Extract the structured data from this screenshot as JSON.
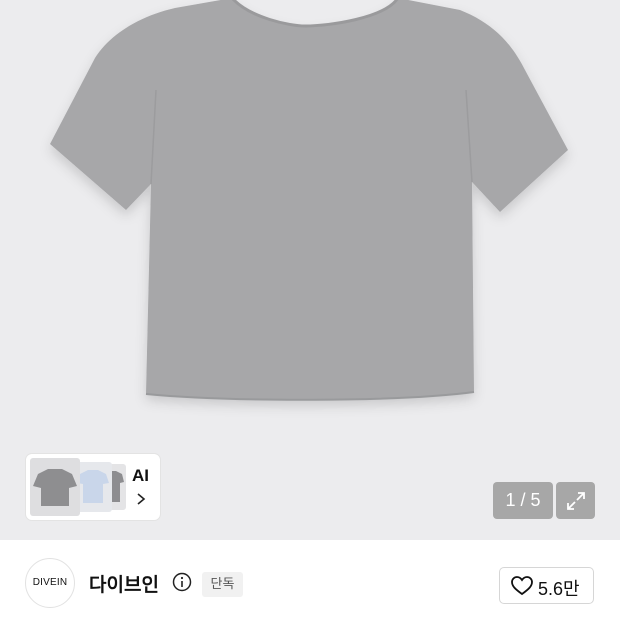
{
  "gallery": {
    "product_image": "gray-tshirt",
    "ai_label": "AI",
    "pager": {
      "current": "1",
      "separator": " / ",
      "total": "5",
      "text": "1 / 5"
    },
    "expand_icon": "expand-arrows-icon",
    "chevron_icon": "chevron-right-icon"
  },
  "brand": {
    "logo_text": "DIVEIN",
    "name": "다이브인",
    "info_icon": "info-icon",
    "badge": "단독",
    "like_icon": "heart-icon",
    "like_count": "5.6만"
  },
  "colors": {
    "shirt": "#a7a7a9",
    "background": "#ececee",
    "overlay": "#8c8c8c"
  }
}
